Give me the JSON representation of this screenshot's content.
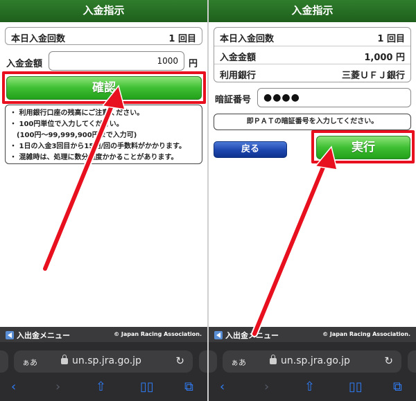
{
  "left": {
    "title": "入金指示",
    "count_label": "本日入金回数",
    "count_value": "1 回目",
    "amount_label": "入金金額",
    "amount_input": "1000",
    "amount_unit": "円",
    "confirm_label": "確認",
    "notes": [
      "・ 利用銀行口座の残高にご注意ください。",
      "・ 100円単位で入力してください。",
      "　(100円〜99,999,900円まで入力可)",
      "・ 1日の入金3回目から15円/回の手数料がかかります。",
      "・ 混雑時は、処理に数分程度かかることがあります。"
    ]
  },
  "right": {
    "title": "入金指示",
    "rows": [
      {
        "label": "本日入金回数",
        "value": "1 回目"
      },
      {
        "label": "入金金額",
        "value": "1,000 円"
      },
      {
        "label": "利用銀行",
        "value": "三菱ＵＦＪ銀行"
      }
    ],
    "pin_label": "暗証番号",
    "pin_value": "●●●●",
    "message": "即ＰＡＴの暗証番号を入力してください。",
    "back_label": "戻る",
    "execute_label": "実行"
  },
  "footer": {
    "menu_label": "入出金メニュー",
    "copyright": "© Japan Racing Association."
  },
  "browser": {
    "aa": "ぁあ",
    "url": "un.sp.jra.go.jp",
    "icons": [
      "back-icon",
      "forward-icon",
      "share-icon",
      "bookmarks-icon",
      "tabs-icon",
      "reload-icon",
      "lock-icon"
    ]
  },
  "colors": {
    "title_green": "#1e5f1c",
    "button_green": "#3fbf33",
    "button_blue": "#1d46ad",
    "highlight_red": "#e8101e",
    "footer_dark": "#3a3a3c"
  }
}
